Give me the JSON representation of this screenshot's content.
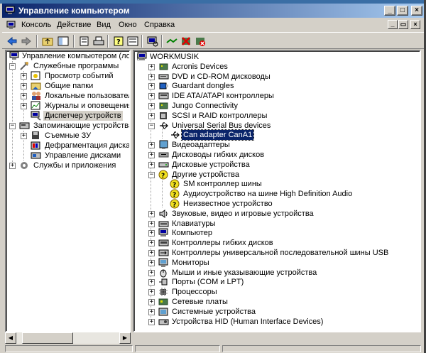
{
  "window": {
    "title": "Управление компьютером"
  },
  "menu": [
    "Консоль",
    "Действие",
    "Вид",
    "Окно",
    "Справка"
  ],
  "caption_buttons": {
    "minimize": "_",
    "maximize": "□",
    "close": "×"
  },
  "mdi_buttons": {
    "minimize": "_",
    "restore": "▭",
    "close": "×"
  },
  "left_tree": [
    {
      "label": "Управление компьютером (локаль",
      "icon": "computer-management-icon"
    },
    {
      "label": "Служебные программы",
      "icon": "tools-icon"
    },
    {
      "label": "Просмотр событий",
      "icon": "event-viewer-icon"
    },
    {
      "label": "Общие папки",
      "icon": "shared-folders-icon"
    },
    {
      "label": "Локальные пользователи",
      "icon": "users-icon"
    },
    {
      "label": "Журналы и оповещения пр",
      "icon": "performance-logs-icon"
    },
    {
      "label": "Диспетчер устройств",
      "icon": "device-manager-icon"
    },
    {
      "label": "Запоминающие устройства",
      "icon": "storage-icon"
    },
    {
      "label": "Съемные ЗУ",
      "icon": "removable-storage-icon"
    },
    {
      "label": "Дефрагментация диска",
      "icon": "defrag-icon"
    },
    {
      "label": "Управление дисками",
      "icon": "disk-management-icon"
    },
    {
      "label": "Службы и приложения",
      "icon": "services-icon"
    }
  ],
  "device_tree": [
    {
      "label": "WORKMUSIK",
      "icon": "computer-icon"
    },
    {
      "label": "Acronis Devices",
      "icon": "device-icon"
    },
    {
      "label": "DVD и CD-ROM дисководы",
      "icon": "cdrom-icon"
    },
    {
      "label": "Guardant dongles",
      "icon": "dongle-icon"
    },
    {
      "label": "IDE ATA/ATAPI контроллеры",
      "icon": "ide-controller-icon"
    },
    {
      "label": "Jungo Connectivity",
      "icon": "device-icon"
    },
    {
      "label": "SCSI и RAID контроллеры",
      "icon": "scsi-icon"
    },
    {
      "label": "Universal Serial Bus devices",
      "icon": "usb-icon"
    },
    {
      "label": "Can adapter CanA1",
      "icon": "usb-icon"
    },
    {
      "label": "Видеоадаптеры",
      "icon": "display-adapter-icon"
    },
    {
      "label": "Дисководы гибких дисков",
      "icon": "floppy-icon"
    },
    {
      "label": "Дисковые устройства",
      "icon": "disk-drive-icon"
    },
    {
      "label": "Другие устройства",
      "icon": "unknown-device-icon"
    },
    {
      "label": "SM контроллер шины",
      "icon": "unknown-device-icon"
    },
    {
      "label": "Аудиоустройство на шине High Definition Audio",
      "icon": "unknown-device-icon"
    },
    {
      "label": "Неизвестное устройство",
      "icon": "unknown-device-icon"
    },
    {
      "label": "Звуковые, видео и игровые устройства",
      "icon": "sound-icon"
    },
    {
      "label": "Клавиатуры",
      "icon": "keyboard-icon"
    },
    {
      "label": "Компьютер",
      "icon": "computer-icon"
    },
    {
      "label": "Контроллеры гибких дисков",
      "icon": "floppy-controller-icon"
    },
    {
      "label": "Контроллеры универсальной последовательной шины USB",
      "icon": "usb-controller-icon"
    },
    {
      "label": "Мониторы",
      "icon": "monitor-icon"
    },
    {
      "label": "Мыши и иные указывающие устройства",
      "icon": "mouse-icon"
    },
    {
      "label": "Порты (COM и LPT)",
      "icon": "port-icon"
    },
    {
      "label": "Процессоры",
      "icon": "processor-icon"
    },
    {
      "label": "Сетевые платы",
      "icon": "network-icon"
    },
    {
      "label": "Системные устройства",
      "icon": "system-device-icon"
    },
    {
      "label": "Устройства HID (Human Interface Devices)",
      "icon": "hid-icon"
    }
  ],
  "colors": {
    "titlebar_start": "#0a246a",
    "titlebar_end": "#a6caf0",
    "face": "#d4d0c8",
    "selection": "#0a246a"
  }
}
